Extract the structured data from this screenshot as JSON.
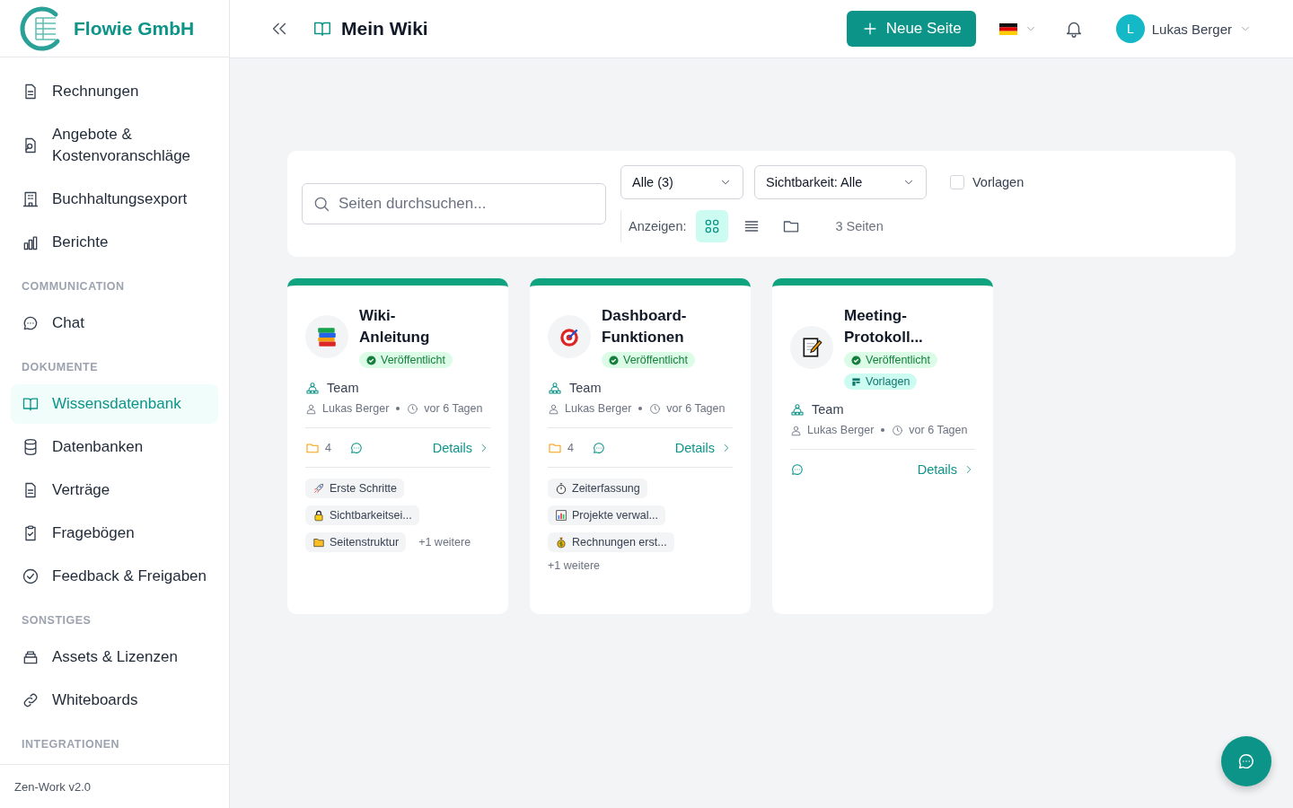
{
  "brand": {
    "name": "Flowie GmbH"
  },
  "sidebar": {
    "sections": [
      {
        "items": [
          {
            "kind": "file",
            "label": "Rechnungen",
            "selected": false
          },
          {
            "kind": "quote",
            "label": "Angebote & Kostenvoranschläge",
            "selected": false
          },
          {
            "kind": "building",
            "label": "Buchhaltungsexport",
            "selected": false
          },
          {
            "kind": "chart",
            "label": "Berichte",
            "selected": false
          }
        ]
      },
      {
        "heading": "COMMUNICATION",
        "items": [
          {
            "kind": "chat",
            "label": "Chat",
            "selected": false
          }
        ]
      },
      {
        "heading": "DOKUMENTE",
        "items": [
          {
            "kind": "book",
            "label": "Wissensdatenbank",
            "selected": true
          },
          {
            "kind": "database",
            "label": "Datenbanken",
            "selected": false
          },
          {
            "kind": "file",
            "label": "Verträge",
            "selected": false
          },
          {
            "kind": "clipboard",
            "label": "Fragebögen",
            "selected": false
          },
          {
            "kind": "check",
            "label": "Feedback & Freigaben",
            "selected": false
          }
        ]
      },
      {
        "heading": "SONSTIGES",
        "items": [
          {
            "kind": "archive",
            "label": "Assets & Lizenzen",
            "selected": false
          },
          {
            "kind": "link",
            "label": "Whiteboards",
            "selected": false
          }
        ]
      },
      {
        "heading": "INTEGRATIONEN"
      }
    ],
    "footer": "Zen-Work v2.0"
  },
  "header": {
    "title": "Mein Wiki",
    "new_page_button": "Neue Seite",
    "user": {
      "initial": "L",
      "name": "Lukas Berger"
    }
  },
  "toolbar": {
    "search": {
      "placeholder": "Seiten durchsuchen..."
    },
    "filters": [
      "Alle (3)",
      "Sichtbarkeit: Alle"
    ],
    "template_filter": {
      "label": "Vorlagen",
      "checked": false
    },
    "view_label": "Anzeigen:",
    "views": [
      {
        "kind": "grid",
        "selected": true
      },
      {
        "kind": "list",
        "selected": false
      },
      {
        "kind": "folder",
        "selected": false
      }
    ],
    "count": "3 Seiten"
  },
  "cards": [
    {
      "kind": "books",
      "title": "Wiki-Anleitung",
      "badges": [
        {
          "kind": "published",
          "label": "Veröffentlicht"
        }
      ],
      "visibility": "Team",
      "author": "Lukas Berger",
      "time": "vor 6 Tagen",
      "folder_count": "4",
      "details": "Details",
      "subpages": [
        {
          "kind": "rocket",
          "label": "Erste Schritte"
        },
        {
          "kind": "lock",
          "label": "Sichtbarkeitsei..."
        },
        {
          "kind": "folder",
          "label": "Seitenstruktur"
        }
      ],
      "more": "+1 weitere"
    },
    {
      "kind": "target",
      "title": "Dashboard-Funktionen",
      "badges": [
        {
          "kind": "published",
          "label": "Veröffentlicht"
        }
      ],
      "visibility": "Team",
      "author": "Lukas Berger",
      "time": "vor 6 Tagen",
      "folder_count": "4",
      "details": "Details",
      "subpages": [
        {
          "kind": "stopwatch",
          "label": "Zeiterfassung"
        },
        {
          "kind": "barchart",
          "label": "Projekte verwal..."
        },
        {
          "kind": "moneybag",
          "label": "Rechnungen erst..."
        }
      ],
      "more": "+1 weitere"
    },
    {
      "kind": "memo",
      "title": "Meeting-Protokoll...",
      "badges": [
        {
          "kind": "published",
          "label": "Veröffentlicht"
        },
        {
          "kind": "template",
          "label": "Vorlagen"
        }
      ],
      "visibility": "Team",
      "author": "Lukas Berger",
      "time": "vor 6 Tagen",
      "details": "Details"
    }
  ]
}
